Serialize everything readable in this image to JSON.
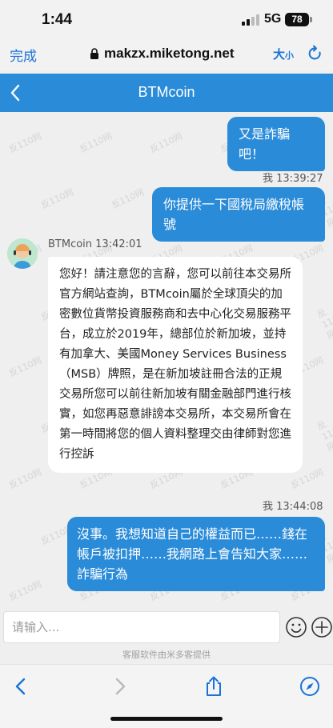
{
  "status": {
    "time": "1:44",
    "network": "5G",
    "battery": "78"
  },
  "browser": {
    "done_label": "完成",
    "url": "makzx.miketong.net",
    "textsize_big": "大",
    "textsize_small": "小"
  },
  "chat": {
    "title": "BTMcoin",
    "messages": [
      {
        "side": "right",
        "text": "又是詐騙吧！"
      },
      {
        "side": "right",
        "meta": "我 13:39:27",
        "text": "你提供一下國稅局繳稅帳號"
      },
      {
        "side": "left",
        "meta": "BTMcoin 13:42:01",
        "text": "您好！請注意您的言辭，您可以前往本交易所官方網站查詢，BTMcoin屬於全球頂尖的加密數位貨幣投資服務商和去中心化交易服務平台，成立於2019年，總部位於新加坡，並持有加拿大、美國Money Services Business（MSB）牌照，是在新加坡註冊合法的正規交易所您可以前往新加坡有關金融部門進行核實，如您再惡意誹謗本交易所，本交易所會在第一時間將您的個人資料整理交由律師對您進行控訴"
      },
      {
        "side": "right",
        "meta": "我 13:44:08",
        "text": "沒事。我想知道自己的權益而已……錢在帳戶被扣押……我網路上會告知大家……詐騙行為"
      }
    ]
  },
  "input": {
    "placeholder": "请输入..."
  },
  "footer": {
    "powered_by": "客服软件由米多客提供"
  },
  "watermark": "反110网",
  "colors": {
    "accent": "#2a8bd8",
    "link": "#1a73d9"
  },
  "icons": [
    "lock-icon",
    "reload-icon",
    "chevron-left-icon",
    "emoji-icon",
    "plus-circle-icon",
    "back-arrow-icon",
    "forward-arrow-icon",
    "share-icon",
    "compass-icon"
  ]
}
